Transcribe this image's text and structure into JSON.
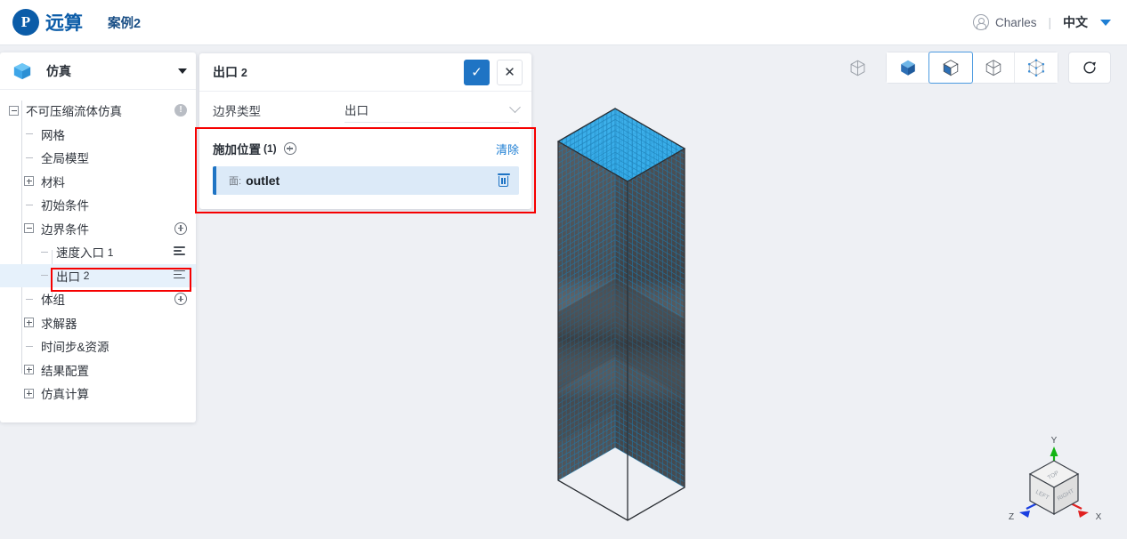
{
  "topbar": {
    "logo_icon": "yuansuan-logo-icon",
    "brand": "远算",
    "case_title": "案例2",
    "user_icon": "user-avatar-icon",
    "user_name": "Charles",
    "separator": "|",
    "language": "中文",
    "caret_icon": "caret-down-icon"
  },
  "sidebar": {
    "header": {
      "icon": "cube-icon",
      "title": "仿真",
      "caret_icon": "caret-down-icon"
    },
    "tree": [
      {
        "label": "不可压缩流体仿真",
        "num": "",
        "toggle": "minus",
        "depth": 0,
        "right_icon": "warning-icon",
        "selected": false
      },
      {
        "label": "网格",
        "num": "",
        "toggle": "dash",
        "depth": 1,
        "right_icon": "",
        "selected": false
      },
      {
        "label": "全局模型",
        "num": "",
        "toggle": "dash",
        "depth": 1,
        "right_icon": "",
        "selected": false
      },
      {
        "label": "材料",
        "num": "",
        "toggle": "plus",
        "depth": 1,
        "right_icon": "",
        "selected": false
      },
      {
        "label": "初始条件",
        "num": "",
        "toggle": "dash",
        "depth": 1,
        "right_icon": "",
        "selected": false
      },
      {
        "label": "边界条件",
        "num": "",
        "toggle": "minus",
        "depth": 1,
        "right_icon": "plus-circle-icon",
        "selected": false
      },
      {
        "label": "速度入口",
        "num": "1",
        "toggle": "dash",
        "depth": 2,
        "right_icon": "list-lines-icon",
        "selected": false
      },
      {
        "label": "出口",
        "num": "2",
        "toggle": "dash",
        "depth": 2,
        "right_icon": "list-lines-icon",
        "selected": true
      },
      {
        "label": "体组",
        "num": "",
        "toggle": "dash",
        "depth": 1,
        "right_icon": "plus-circle-icon",
        "selected": false
      },
      {
        "label": "求解器",
        "num": "",
        "toggle": "plus",
        "depth": 1,
        "right_icon": "",
        "selected": false
      },
      {
        "label": "时间步&资源",
        "num": "",
        "toggle": "dash",
        "depth": 1,
        "right_icon": "",
        "selected": false
      },
      {
        "label": "结果配置",
        "num": "",
        "toggle": "plus",
        "depth": 1,
        "right_icon": "",
        "selected": false
      },
      {
        "label": "仿真计算",
        "num": "",
        "toggle": "plus",
        "depth": 1,
        "right_icon": "",
        "selected": false
      }
    ]
  },
  "panel": {
    "title": "出口",
    "title_num": "2",
    "confirm_icon": "check-icon",
    "cancel_icon": "close-icon",
    "boundary_type": {
      "label": "边界类型",
      "value": "出口",
      "chevron_icon": "chevron-down-icon"
    },
    "locations": {
      "title": "施加位置",
      "count": "(1)",
      "add_icon": "plus-circle-icon",
      "clear_label": "清除",
      "items": [
        {
          "kind": "面:",
          "name": "outlet",
          "delete_icon": "trash-icon"
        }
      ]
    }
  },
  "viewport": {
    "toolbar": {
      "buttons": [
        {
          "name": "fit-view-button",
          "icon": "wire-cube-icon",
          "active": false,
          "grouped": false
        },
        {
          "name": "shaded-view-button",
          "icon": "solid-cube-icon",
          "active": false,
          "grouped": true
        },
        {
          "name": "shaded-edges-button",
          "icon": "solid-edge-cube-icon",
          "active": true,
          "grouped": true
        },
        {
          "name": "wireframe-button",
          "icon": "wireframe-cube-icon",
          "active": false,
          "grouped": true
        },
        {
          "name": "points-button",
          "icon": "points-cube-icon",
          "active": false,
          "grouped": true
        },
        {
          "name": "reset-view-button",
          "icon": "reset-rotate-icon",
          "active": false,
          "grouped": false
        }
      ]
    },
    "axis_widget": {
      "x_label": "X",
      "y_label": "Y",
      "z_label": "Z",
      "faces": [
        "LEFT",
        "TOP",
        "RIGHT"
      ]
    },
    "model": {
      "name": "mesh-box-model",
      "highlight_face": "outlet"
    }
  },
  "annotations": [
    {
      "name": "red-highlight-tree-item"
    },
    {
      "name": "red-highlight-locations-section"
    }
  ],
  "colors": {
    "brand": "#0b5ca8",
    "accent": "#1f74c4",
    "link": "#1f7fd4",
    "annotation": "#f60000",
    "selection_bg": "#e6f1fb",
    "highlight_face": "#29a8e8",
    "model_body": "#45494e",
    "canvas_bg": "#eef0f4"
  }
}
